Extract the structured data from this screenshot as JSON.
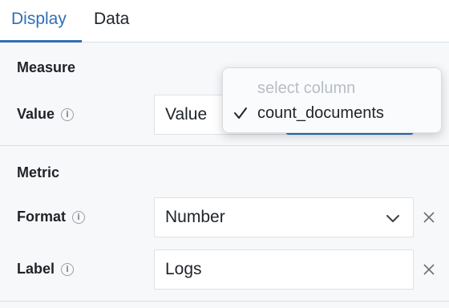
{
  "tabs": [
    {
      "label": "Display",
      "active": true
    },
    {
      "label": "Data",
      "active": false
    }
  ],
  "measure": {
    "section_title": "Measure",
    "value_label": "Value",
    "value_field_text": "Value"
  },
  "dropdown": {
    "placeholder": "select column",
    "options": [
      {
        "label": "count_documents",
        "selected": true
      }
    ]
  },
  "metric": {
    "section_title": "Metric",
    "format_label": "Format",
    "format_value": "Number",
    "label_label": "Label",
    "label_value": "Logs"
  },
  "icons": {
    "info": "info-circle-icon",
    "clear": "close-icon",
    "chevron": "chevron-down-icon",
    "check": "checkmark-icon"
  },
  "colors": {
    "accent": "#2f6fb3",
    "background": "#f7f8fa"
  }
}
